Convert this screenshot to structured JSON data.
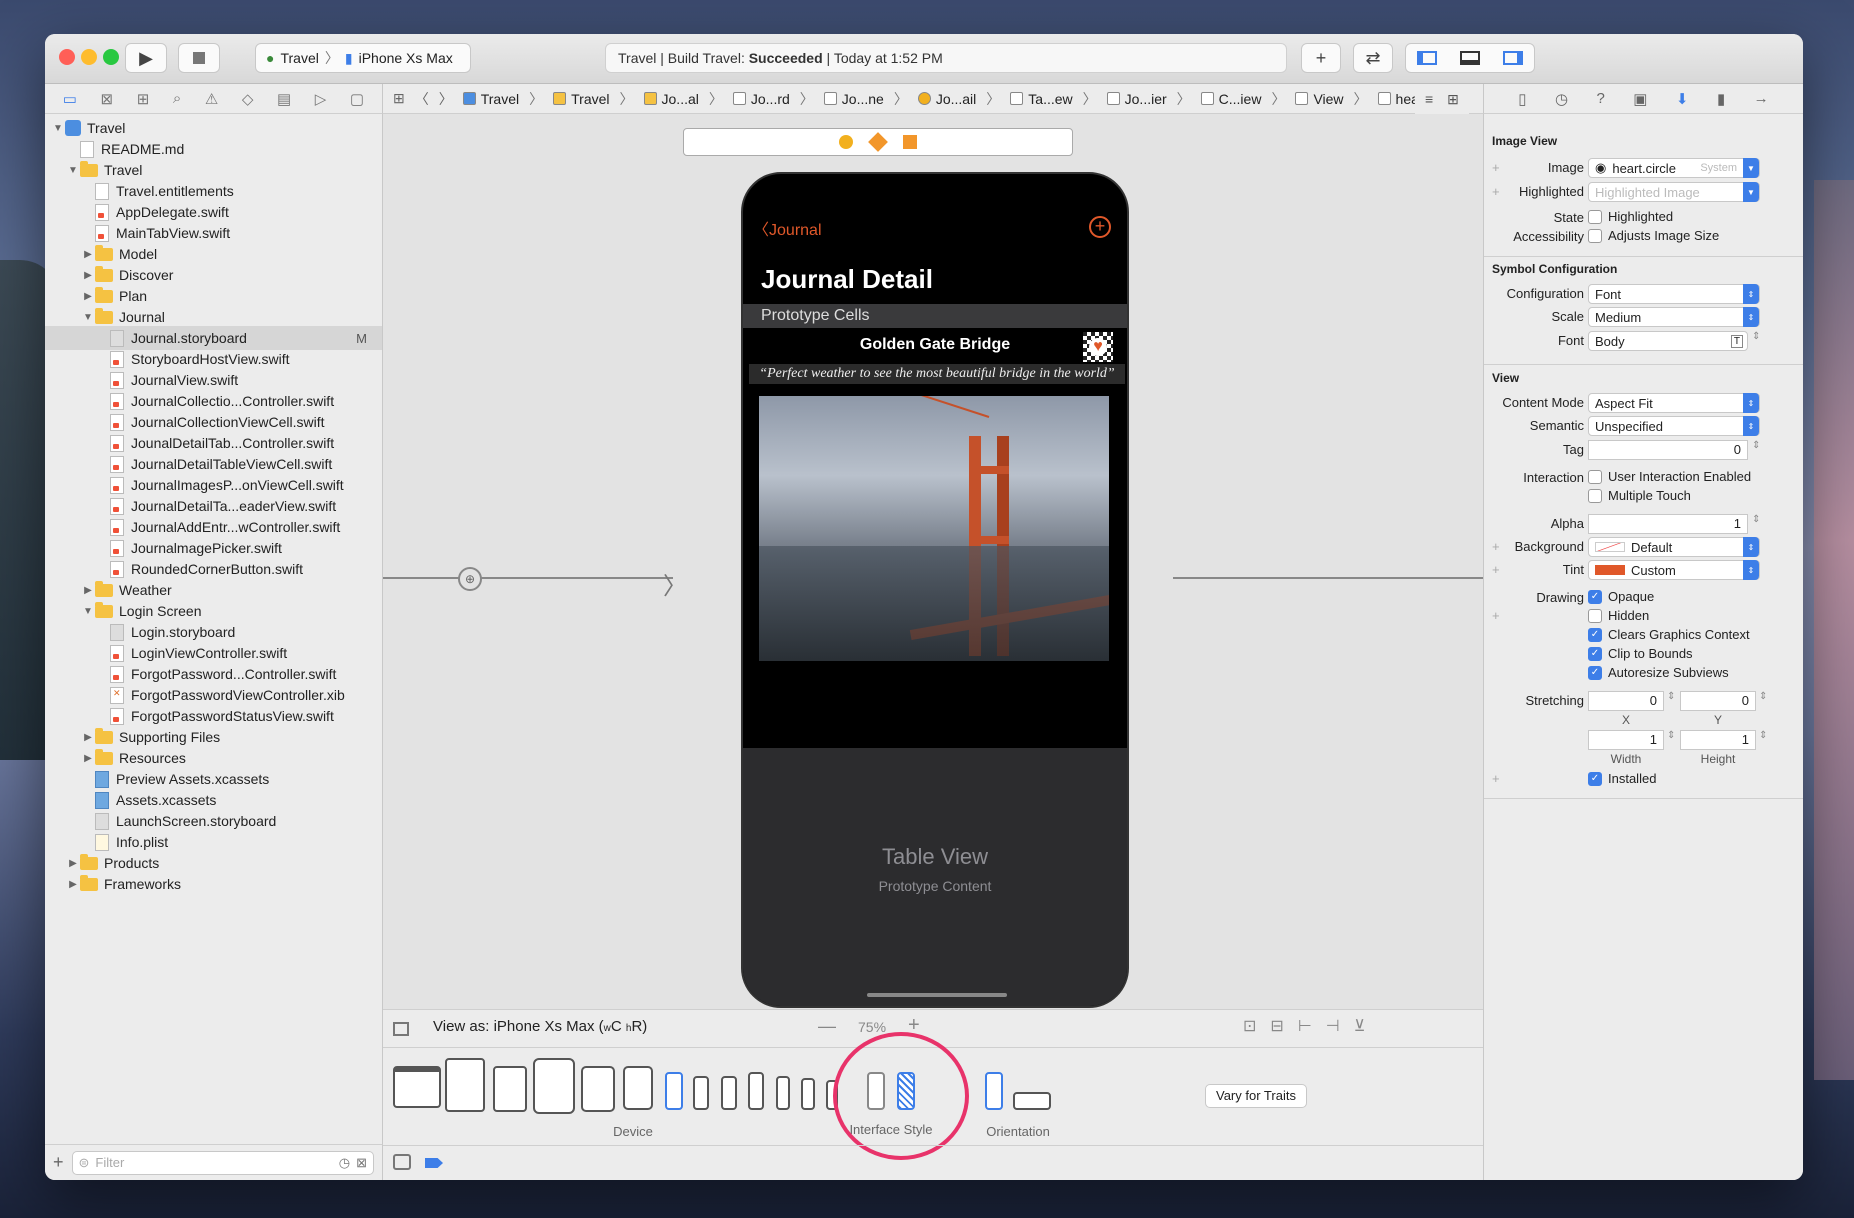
{
  "titlebar": {
    "scheme_project": "Travel",
    "scheme_device": "iPhone Xs Max",
    "status_prefix": "Travel | Build Travel: ",
    "status_result": "Succeeded",
    "status_time": "| Today at 1:52 PM"
  },
  "navigator": {
    "tree": [
      {
        "label": "Travel",
        "kind": "project",
        "indent": 0,
        "disclosure": "open"
      },
      {
        "label": "README.md",
        "kind": "file",
        "indent": 1
      },
      {
        "label": "Travel",
        "kind": "folder",
        "indent": 1,
        "disclosure": "open"
      },
      {
        "label": "Travel.entitlements",
        "kind": "file",
        "indent": 2
      },
      {
        "label": "AppDelegate.swift",
        "kind": "swift",
        "indent": 2
      },
      {
        "label": "MainTabView.swift",
        "kind": "swift",
        "indent": 2
      },
      {
        "label": "Model",
        "kind": "folder",
        "indent": 2,
        "disclosure": "closed"
      },
      {
        "label": "Discover",
        "kind": "folder",
        "indent": 2,
        "disclosure": "closed"
      },
      {
        "label": "Plan",
        "kind": "folder",
        "indent": 2,
        "disclosure": "closed"
      },
      {
        "label": "Journal",
        "kind": "folder",
        "indent": 2,
        "disclosure": "open"
      },
      {
        "label": "Journal.storyboard",
        "kind": "sb",
        "indent": 3,
        "selected": true,
        "badge": "M"
      },
      {
        "label": "StoryboardHostView.swift",
        "kind": "swift",
        "indent": 3
      },
      {
        "label": "JournalView.swift",
        "kind": "swift",
        "indent": 3
      },
      {
        "label": "JournalCollectio...Controller.swift",
        "kind": "swift",
        "indent": 3
      },
      {
        "label": "JournalCollectionViewCell.swift",
        "kind": "swift",
        "indent": 3
      },
      {
        "label": "JounalDetailTab...Controller.swift",
        "kind": "swift",
        "indent": 3
      },
      {
        "label": "JournalDetailTableViewCell.swift",
        "kind": "swift",
        "indent": 3
      },
      {
        "label": "JournalImagesP...onViewCell.swift",
        "kind": "swift",
        "indent": 3
      },
      {
        "label": "JournalDetailTa...eaderView.swift",
        "kind": "swift",
        "indent": 3
      },
      {
        "label": "JournalAddEntr...wController.swift",
        "kind": "swift",
        "indent": 3
      },
      {
        "label": "JournalmagePicker.swift",
        "kind": "swift",
        "indent": 3
      },
      {
        "label": "RoundedCornerButton.swift",
        "kind": "swift",
        "indent": 3
      },
      {
        "label": "Weather",
        "kind": "folder",
        "indent": 2,
        "disclosure": "closed"
      },
      {
        "label": "Login Screen",
        "kind": "folder",
        "indent": 2,
        "disclosure": "open"
      },
      {
        "label": "Login.storyboard",
        "kind": "sb",
        "indent": 3
      },
      {
        "label": "LoginViewController.swift",
        "kind": "swift",
        "indent": 3
      },
      {
        "label": "ForgotPassword...Controller.swift",
        "kind": "swift",
        "indent": 3
      },
      {
        "label": "ForgotPasswordViewController.xib",
        "kind": "xib",
        "indent": 3
      },
      {
        "label": "ForgotPasswordStatusView.swift",
        "kind": "swift",
        "indent": 3
      },
      {
        "label": "Supporting Files",
        "kind": "folder",
        "indent": 2,
        "disclosure": "closed"
      },
      {
        "label": "Resources",
        "kind": "folder",
        "indent": 2,
        "disclosure": "closed"
      },
      {
        "label": "Preview Assets.xcassets",
        "kind": "asset",
        "indent": 2
      },
      {
        "label": "Assets.xcassets",
        "kind": "asset",
        "indent": 2
      },
      {
        "label": "LaunchScreen.storyboard",
        "kind": "sb",
        "indent": 2
      },
      {
        "label": "Info.plist",
        "kind": "plist",
        "indent": 2
      },
      {
        "label": "Products",
        "kind": "folder",
        "indent": 1,
        "disclosure": "closed"
      },
      {
        "label": "Frameworks",
        "kind": "folder",
        "indent": 1,
        "disclosure": "closed"
      }
    ],
    "filter_placeholder": "Filter"
  },
  "jumpbar": [
    "Travel",
    "Travel",
    "Jo...al",
    "Jo...rd",
    "Jo...ne",
    "Jo...ail",
    "Ta...ew",
    "Jo...ier",
    "C...iew",
    "View",
    "heart.circle"
  ],
  "phone": {
    "back_label": "Journal",
    "large_title": "Journal Detail",
    "section_header": "Prototype Cells",
    "cell_title": "Golden Gate Bridge",
    "cell_quote": "“Perfect weather to see the most beautiful bridge in the world”",
    "table_title": "Table View",
    "table_subtitle": "Prototype Content"
  },
  "device_bar": {
    "view_as": "View as: iPhone Xs Max (",
    "traits_w": "w",
    "traits_c": "C",
    "traits_h": "h",
    "traits_r": "R)",
    "zoom": "75%",
    "device_label": "Device",
    "interface_style_label": "Interface Style",
    "orientation_label": "Orientation",
    "vary_button": "Vary for Traits"
  },
  "inspector": {
    "image_view_title": "Image View",
    "image_label": "Image",
    "image_value": "heart.circle",
    "image_tag": "System",
    "highlighted_label": "Highlighted",
    "highlighted_placeholder": "Highlighted Image",
    "state_label": "State",
    "state_check": "Highlighted",
    "accessibility_label": "Accessibility",
    "accessibility_check": "Adjusts Image Size",
    "symbol_title": "Symbol Configuration",
    "configuration_label": "Configuration",
    "configuration_value": "Font",
    "scale_label": "Scale",
    "scale_value": "Medium",
    "font_label": "Font",
    "font_value": "Body",
    "view_title": "View",
    "content_mode_label": "Content Mode",
    "content_mode_value": "Aspect Fit",
    "semantic_label": "Semantic",
    "semantic_value": "Unspecified",
    "tag_label": "Tag",
    "tag_value": "0",
    "interaction_label": "Interaction",
    "user_interaction": "User Interaction Enabled",
    "multiple_touch": "Multiple Touch",
    "alpha_label": "Alpha",
    "alpha_value": "1",
    "background_label": "Background",
    "background_value": "Default",
    "tint_label": "Tint",
    "tint_value": "Custom",
    "drawing_label": "Drawing",
    "opaque": "Opaque",
    "hidden": "Hidden",
    "clears": "Clears Graphics Context",
    "clip": "Clip to Bounds",
    "autoresize": "Autoresize Subviews",
    "stretching_label": "Stretching",
    "stretch_x": "0",
    "stretch_y": "0",
    "stretch_w": "1",
    "stretch_h": "1",
    "x_label": "X",
    "y_label": "Y",
    "width_label": "Width",
    "height_label": "Height",
    "installed": "Installed"
  },
  "colors": {
    "accent": "#3d7ee8",
    "tint": "#e0582a",
    "highlight_ring": "#e8336a"
  }
}
